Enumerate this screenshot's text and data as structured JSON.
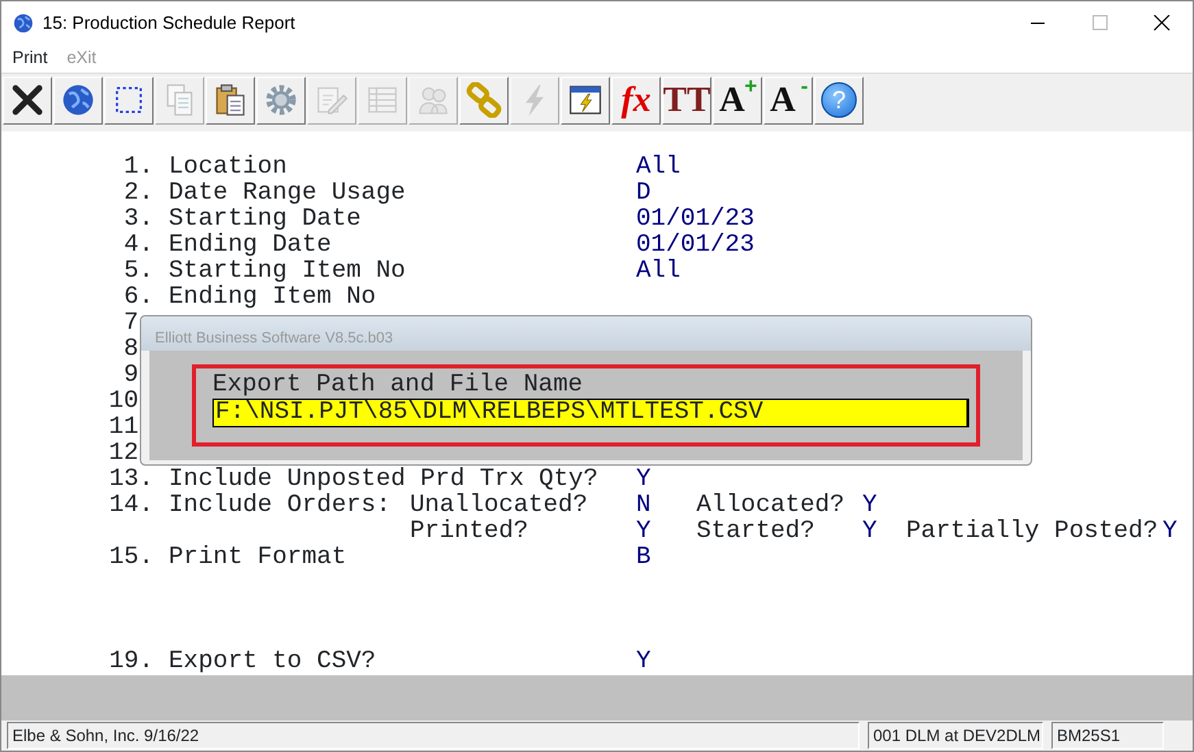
{
  "window": {
    "title": "15: Production Schedule Report"
  },
  "menu": [
    {
      "label": "Print",
      "disabled": false
    },
    {
      "label": "eXit",
      "disabled": true
    }
  ],
  "toolbar": [
    {
      "kind": "icon",
      "disabled": false
    },
    {
      "kind": "icon",
      "disabled": false
    },
    {
      "kind": "icon",
      "disabled": false
    },
    {
      "kind": "icon",
      "disabled": true
    },
    {
      "kind": "icon",
      "disabled": false
    },
    {
      "kind": "icon",
      "disabled": false
    },
    {
      "kind": "icon",
      "disabled": true
    },
    {
      "kind": "icon",
      "disabled": true
    },
    {
      "kind": "icon",
      "disabled": true
    },
    {
      "kind": "icon",
      "disabled": false
    },
    {
      "kind": "icon",
      "disabled": true
    },
    {
      "kind": "icon",
      "disabled": false
    },
    {
      "kind": "glyph",
      "glyph": "fx",
      "disabled": false
    },
    {
      "kind": "glyph",
      "glyph": "TT",
      "disabled": false
    },
    {
      "kind": "glyph",
      "glyph": "A",
      "sign": "+",
      "disabled": false
    },
    {
      "kind": "glyph",
      "glyph": "A",
      "sign": "-",
      "disabled": false
    },
    {
      "kind": "help",
      "glyph": "?",
      "disabled": false
    }
  ],
  "options": [
    {
      "kind": "option",
      "number": "1.",
      "label": "Location",
      "value": "All"
    },
    {
      "kind": "option",
      "number": "2.",
      "label": "Date Range Usage",
      "value": "D"
    },
    {
      "kind": "option",
      "number": "3.",
      "label": "Starting Date",
      "value": "01/01/23"
    },
    {
      "kind": "option",
      "number": "4.",
      "label": "Ending Date",
      "value": "01/01/23"
    },
    {
      "kind": "option",
      "number": "5.",
      "label": "Starting Item No",
      "value": "All"
    },
    {
      "kind": "option",
      "number": "6.",
      "label": "Ending Item No"
    },
    {
      "kind": "option",
      "number": "7"
    },
    {
      "kind": "option",
      "number": "8"
    },
    {
      "kind": "option",
      "number": "9"
    },
    {
      "kind": "option",
      "number": "10"
    },
    {
      "kind": "option",
      "number": "11"
    },
    {
      "kind": "option",
      "number": "12"
    },
    {
      "kind": "option",
      "number": "13.",
      "label": "Include Unposted Prd Trx Qty?",
      "value": "Y"
    },
    {
      "kind": "orders",
      "number": "14.",
      "label": "Include Orders:",
      "lines": [
        [
          {
            "question": "Unallocated?",
            "value": "N"
          },
          {
            "question": "Allocated?",
            "value": "Y"
          }
        ],
        [
          {
            "question": "Printed?",
            "value": "Y"
          },
          {
            "question": "Started?",
            "value": "Y"
          },
          {
            "question": "Partially Posted?",
            "value": "Y"
          }
        ]
      ]
    },
    {
      "kind": "option",
      "number": "15.",
      "label": "Print Format",
      "value": "B"
    },
    {
      "kind": "blank"
    },
    {
      "kind": "blank"
    },
    {
      "kind": "blank"
    },
    {
      "kind": "option",
      "number": "19.",
      "label": "Export to CSV?",
      "value": "Y"
    }
  ],
  "dialog": {
    "title": "Elliott Business Software V8.5c.b03",
    "label": "Export Path and File Name",
    "value": "F:\\NSI.PJT\\85\\DLM\\RELBEPS\\MTLTEST.CSV"
  },
  "status_bar": [
    "Elbe & Sohn, Inc. 9/16/22",
    "001 DLM at DEV2DLM",
    "BM25S1"
  ]
}
